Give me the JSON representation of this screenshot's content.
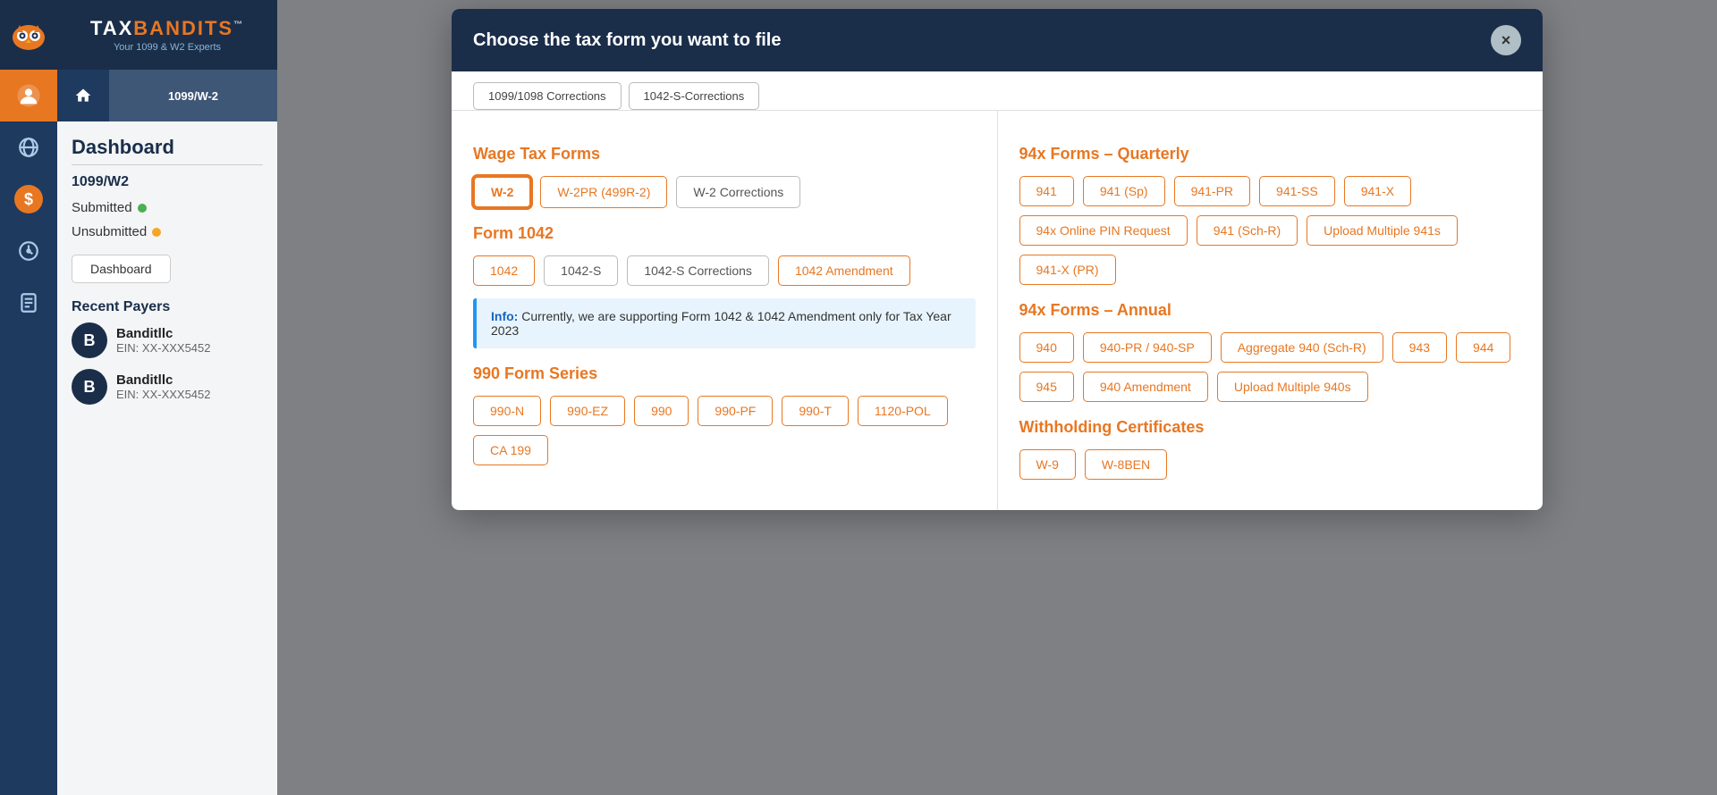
{
  "app": {
    "name": "TaxBandits",
    "tagline": "Your 1099 & W2 Experts"
  },
  "sidebar": {
    "title": "Dashboard",
    "nav": {
      "home_label": "1099/W-2"
    },
    "menu": {
      "section_label": "1099/W2",
      "submitted_label": "Submitted",
      "unsubmitted_label": "Unsubmitted",
      "dashboard_btn": "Dashboard"
    },
    "recent_payers_title": "Recent Payers",
    "payers": [
      {
        "name": "Banditllc",
        "ein": "EIN: XX-XXX5452",
        "initial": "B"
      },
      {
        "name": "Banditllc",
        "ein": "EIN: XX-XXX5452",
        "initial": "B"
      }
    ]
  },
  "modal": {
    "title": "Choose the tax form you want to file",
    "close_label": "×",
    "tabs": [
      {
        "label": "1099/1098 Corrections"
      },
      {
        "label": "1042-S-Corrections"
      }
    ],
    "wage_tax": {
      "section_title": "Wage Tax Forms",
      "buttons": [
        {
          "label": "W-2",
          "selected": true
        },
        {
          "label": "W-2PR (499R-2)",
          "selected": false
        },
        {
          "label": "W-2 Corrections",
          "gray": true
        }
      ]
    },
    "form_1042": {
      "section_title": "Form 1042",
      "buttons": [
        {
          "label": "1042",
          "selected": false
        },
        {
          "label": "1042-S",
          "selected": false,
          "gray": true
        },
        {
          "label": "1042-S Corrections",
          "selected": false,
          "gray": true
        },
        {
          "label": "1042 Amendment",
          "selected": false
        }
      ],
      "info_text": "Info: Currently, we are supporting Form 1042 & 1042 Amendment only for Tax Year 2023"
    },
    "form_990": {
      "section_title": "990 Form Series",
      "buttons": [
        {
          "label": "990-N"
        },
        {
          "label": "990-EZ"
        },
        {
          "label": "990"
        },
        {
          "label": "990-PF"
        },
        {
          "label": "990-T"
        },
        {
          "label": "1120-POL"
        },
        {
          "label": "CA 199"
        }
      ]
    },
    "quarterly_94x": {
      "section_title": "94x Forms – Quarterly",
      "buttons": [
        {
          "label": "941"
        },
        {
          "label": "941 (Sp)"
        },
        {
          "label": "941-PR"
        },
        {
          "label": "941-SS"
        },
        {
          "label": "941-X"
        },
        {
          "label": "94x Online PIN Request"
        },
        {
          "label": "941 (Sch-R)"
        },
        {
          "label": "Upload Multiple 941s"
        },
        {
          "label": "941-X (PR)"
        }
      ]
    },
    "annual_94x": {
      "section_title": "94x Forms – Annual",
      "buttons": [
        {
          "label": "940"
        },
        {
          "label": "940-PR / 940-SP"
        },
        {
          "label": "Aggregate 940 (Sch-R)"
        },
        {
          "label": "943"
        },
        {
          "label": "944"
        },
        {
          "label": "945"
        },
        {
          "label": "940 Amendment"
        },
        {
          "label": "Upload Multiple 940s"
        }
      ]
    },
    "withholding": {
      "section_title": "Withholding Certificates",
      "buttons": [
        {
          "label": "W-9"
        },
        {
          "label": "W-8BEN"
        }
      ]
    }
  }
}
